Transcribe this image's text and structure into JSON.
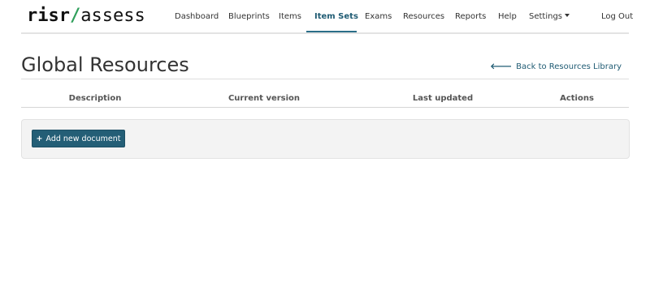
{
  "logo": {
    "part1": "risr",
    "slash": "/",
    "part2": "assess"
  },
  "nav": {
    "items": [
      {
        "label": "Dashboard"
      },
      {
        "label": "Blueprints"
      },
      {
        "label": "Items"
      },
      {
        "label": "Item Sets"
      },
      {
        "label": "Exams"
      },
      {
        "label": "Resources"
      },
      {
        "label": "Reports"
      },
      {
        "label": "Help"
      },
      {
        "label": "Settings"
      },
      {
        "label": "Log Out"
      }
    ],
    "active": "Item Sets"
  },
  "page": {
    "title": "Global Resources",
    "back_link_arrow": "🡐",
    "back_link": "Back to Resources Library"
  },
  "table": {
    "columns": [
      "Description",
      "Current version",
      "Last updated",
      "Actions"
    ]
  },
  "panel": {
    "add_button_icon": "+",
    "add_button_label": "Add new document"
  },
  "colors": {
    "accent": "#245e76",
    "logo_slash": "#2f9f5b"
  }
}
